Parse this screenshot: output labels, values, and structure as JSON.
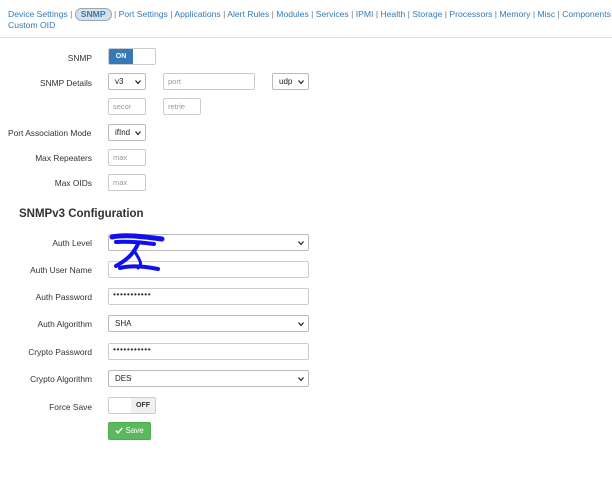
{
  "nav": {
    "line1": [
      "Device Settings",
      "SNMP",
      "Port Settings",
      "Applications",
      "Alert Rules",
      "Modules",
      "Services",
      "IPMI",
      "Health",
      "Storage",
      "Processors",
      "Memory",
      "Misc",
      "Components"
    ],
    "line2": [
      "Custom OID"
    ],
    "active": "SNMP"
  },
  "snmp": {
    "label": "SNMP",
    "toggle_on": "ON"
  },
  "details": {
    "label": "SNMP Details",
    "version": "v3",
    "port_placeholder": "port",
    "transport": "udp",
    "seconds_placeholder": "secor",
    "retries_placeholder": "retrie"
  },
  "port_assoc": {
    "label": "Port Association Mode",
    "value": "ifInd"
  },
  "max_repeaters": {
    "label": "Max Repeaters",
    "placeholder": "max"
  },
  "max_oids": {
    "label": "Max OIDs",
    "placeholder": "max"
  },
  "v3": {
    "title": "SNMPv3 Configuration",
    "auth_level_label": "Auth Level",
    "auth_user_label": "Auth User Name",
    "auth_password_label": "Auth Password",
    "auth_password_value": "•••••••••••",
    "auth_algo_label": "Auth Algorithm",
    "auth_algo_value": "SHA",
    "crypto_password_label": "Crypto Password",
    "crypto_password_value": "•••••••••••",
    "crypto_algo_label": "Crypto Algorithm",
    "crypto_algo_value": "DES",
    "force_save_label": "Force Save",
    "force_save_off": "OFF"
  },
  "save_button": "Save",
  "colors": {
    "primary": "#337ab7",
    "success": "#5cb85c",
    "redaction": "#1010ee"
  }
}
